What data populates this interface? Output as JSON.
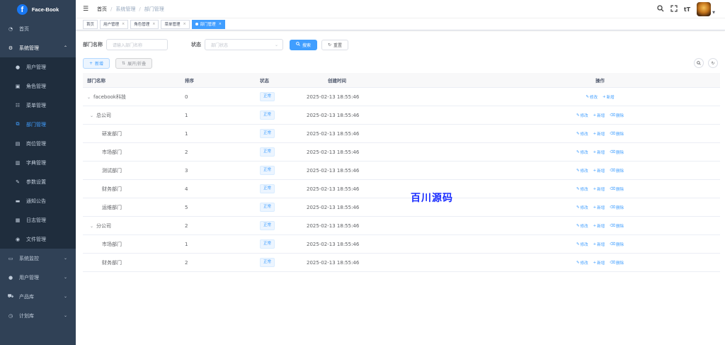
{
  "app": {
    "name": "Face-Book",
    "logo_letter": "f"
  },
  "sidebar": {
    "items": [
      {
        "label": "首页",
        "icon": "dashboard-icon"
      },
      {
        "label": "系统管理",
        "icon": "gear-icon",
        "open": true
      },
      {
        "label": "用户管理",
        "icon": "user-icon",
        "sub": true
      },
      {
        "label": "角色管理",
        "icon": "role-icon",
        "sub": true
      },
      {
        "label": "菜单管理",
        "icon": "menu-icon",
        "sub": true
      },
      {
        "label": "部门管理",
        "icon": "tree-icon",
        "sub": true,
        "active": true
      },
      {
        "label": "岗位管理",
        "icon": "post-icon",
        "sub": true
      },
      {
        "label": "字典管理",
        "icon": "dict-icon",
        "sub": true
      },
      {
        "label": "参数设置",
        "icon": "edit-icon",
        "sub": true
      },
      {
        "label": "通知公告",
        "icon": "message-icon",
        "sub": true
      },
      {
        "label": "日志管理",
        "icon": "log-icon",
        "sub": true
      },
      {
        "label": "文件管理",
        "icon": "file-icon",
        "sub": true
      },
      {
        "label": "系统监控",
        "icon": "monitor-icon"
      },
      {
        "label": "用户管理",
        "icon": "users-icon"
      },
      {
        "label": "产品库",
        "icon": "cart-icon"
      },
      {
        "label": "计划库",
        "icon": "clock-icon"
      }
    ]
  },
  "breadcrumb": [
    "首页",
    "系统管理",
    "部门管理"
  ],
  "tags": [
    {
      "label": "首页",
      "closable": false
    },
    {
      "label": "用户管理",
      "closable": true
    },
    {
      "label": "角色管理",
      "closable": true
    },
    {
      "label": "菜单管理",
      "closable": true
    },
    {
      "label": "部门管理",
      "closable": true,
      "active": true
    }
  ],
  "search": {
    "name_label": "部门名称",
    "name_placeholder": "请输入部门名称",
    "status_label": "状态",
    "status_placeholder": "部门状态",
    "search_btn": "搜索",
    "reset_btn": "重置"
  },
  "toolbar": {
    "add_btn": "新增",
    "expand_btn": "展开/折叠"
  },
  "table": {
    "headers": {
      "name": "部门名称",
      "order": "排序",
      "status": "状态",
      "time": "创建时间",
      "ops": "操作"
    },
    "ops": {
      "edit": "修改",
      "add": "新增",
      "delete": "删除"
    },
    "rows": [
      {
        "name": "facebook科技",
        "level": 0,
        "toggle": true,
        "order": "0",
        "status": "正常",
        "time": "2025-02-13 18:55:46",
        "delete": false
      },
      {
        "name": "总公司",
        "level": 1,
        "toggle": true,
        "order": "1",
        "status": "正常",
        "time": "2025-02-13 18:55:46",
        "delete": true
      },
      {
        "name": "研发部门",
        "level": 2,
        "toggle": false,
        "order": "1",
        "status": "正常",
        "time": "2025-02-13 18:55:46",
        "delete": true
      },
      {
        "name": "市场部门",
        "level": 2,
        "toggle": false,
        "order": "2",
        "status": "正常",
        "time": "2025-02-13 18:55:46",
        "delete": true
      },
      {
        "name": "测试部门",
        "level": 2,
        "toggle": false,
        "order": "3",
        "status": "正常",
        "time": "2025-02-13 18:55:46",
        "delete": true
      },
      {
        "name": "财务部门",
        "level": 2,
        "toggle": false,
        "order": "4",
        "status": "正常",
        "time": "2025-02-13 18:55:46",
        "delete": true
      },
      {
        "name": "运维部门",
        "level": 2,
        "toggle": false,
        "order": "5",
        "status": "正常",
        "time": "2025-02-13 18:55:46",
        "delete": true
      },
      {
        "name": "分公司",
        "level": 1,
        "toggle": true,
        "order": "2",
        "status": "正常",
        "time": "2025-02-13 18:55:46",
        "delete": true
      },
      {
        "name": "市场部门",
        "level": 2,
        "toggle": false,
        "order": "1",
        "status": "正常",
        "time": "2025-02-13 18:55:46",
        "delete": true
      },
      {
        "name": "财务部门",
        "level": 2,
        "toggle": false,
        "order": "2",
        "status": "正常",
        "time": "2025-02-13 18:55:46",
        "delete": true
      }
    ]
  },
  "watermark": "百川源码",
  "colors": {
    "sidebar_bg": "#304156",
    "primary": "#409eff",
    "submenu_bg": "#1f2d3d"
  }
}
